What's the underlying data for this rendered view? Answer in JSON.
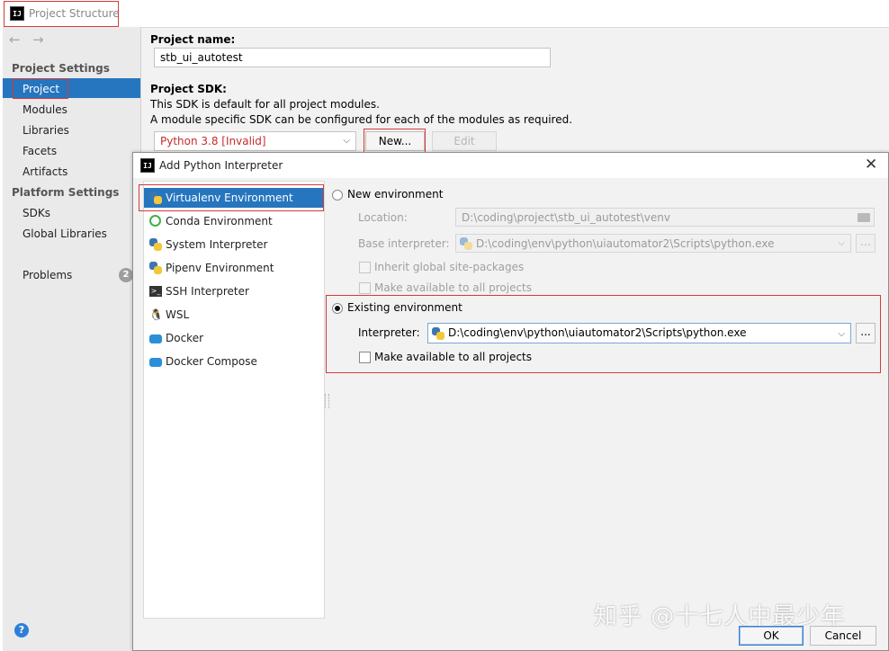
{
  "window": {
    "title": "Project Structure"
  },
  "sidebar": {
    "project_settings_heading": "Project Settings",
    "project_settings_items": [
      "Project",
      "Modules",
      "Libraries",
      "Facets",
      "Artifacts"
    ],
    "platform_settings_heading": "Platform Settings",
    "platform_settings_items": [
      "SDKs",
      "Global Libraries"
    ],
    "problems_label": "Problems",
    "problems_count": "2",
    "help_symbol": "?"
  },
  "project": {
    "name_label": "Project name:",
    "name_value": "stb_ui_autotest",
    "sdk_label": "Project SDK:",
    "sdk_desc1": "This SDK is default for all project modules.",
    "sdk_desc2": "A module specific SDK can be configured for each of the modules as required.",
    "sdk_value": "Python 3.8 [Invalid]",
    "new_button": "New...",
    "edit_button": "Edit",
    "sdk_invalid_color": "#c62b2b"
  },
  "dialog": {
    "title": "Add Python Interpreter",
    "close_symbol": "✕",
    "list": [
      {
        "label": "Virtualenv Environment",
        "icon": "virtualenv-icon"
      },
      {
        "label": "Conda Environment",
        "icon": "conda-icon"
      },
      {
        "label": "System Interpreter",
        "icon": "python-icon"
      },
      {
        "label": "Pipenv Environment",
        "icon": "pipenv-icon"
      },
      {
        "label": "SSH Interpreter",
        "icon": "terminal-icon"
      },
      {
        "label": "WSL",
        "icon": "linux-icon"
      },
      {
        "label": "Docker",
        "icon": "docker-icon"
      },
      {
        "label": "Docker Compose",
        "icon": "docker-compose-icon"
      }
    ],
    "new_env": {
      "label": "New environment",
      "location_label": "Location:",
      "location_value": "D:\\coding\\project\\stb_ui_autotest\\venv",
      "base_label": "Base interpreter:",
      "base_value": "D:\\coding\\env\\python\\uiautomator2\\Scripts\\python.exe",
      "inherit_label": "Inherit global site-packages",
      "make_available_label": "Make available to all projects",
      "browse_symbol": "..."
    },
    "existing_env": {
      "label": "Existing environment",
      "interpreter_label": "Interpreter:",
      "interpreter_value": "D:\\coding\\env\\python\\uiautomator2\\Scripts\\python.exe",
      "browse_symbol": "...",
      "make_available_label": "Make available to all projects"
    },
    "ok_button": "OK",
    "cancel_button": "Cancel"
  },
  "watermark": "知乎 @十七人中最少年",
  "colors": {
    "selection": "#2675bf",
    "highlight": "#d43a3a"
  }
}
